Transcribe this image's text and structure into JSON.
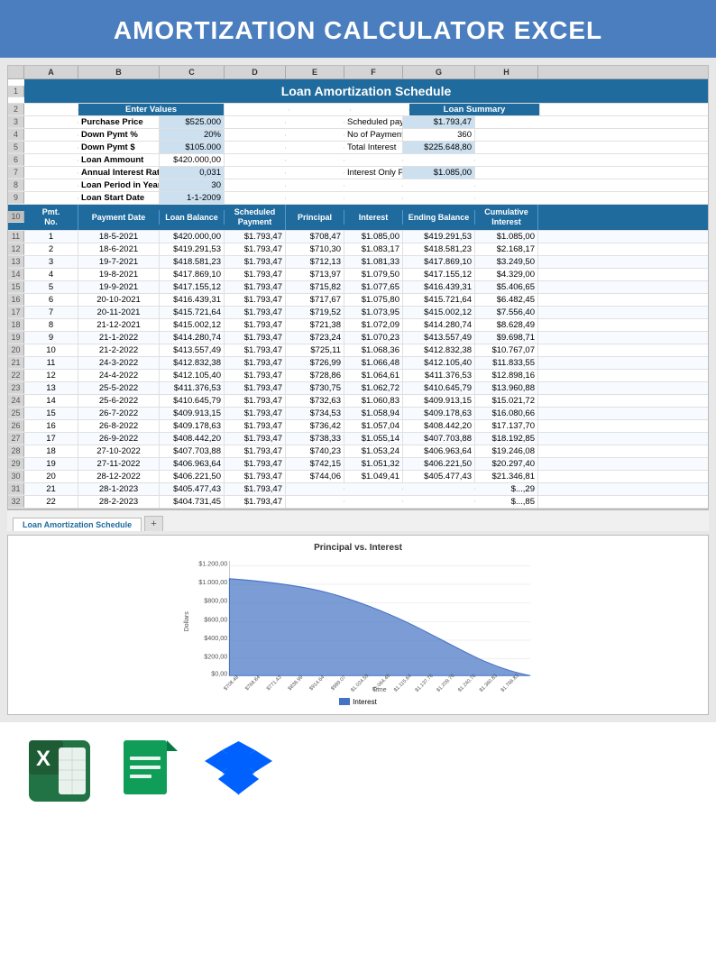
{
  "header": {
    "title": "AMORTIZATION CALCULATOR EXCEL"
  },
  "spreadsheet": {
    "col_headers": [
      "",
      "A",
      "B",
      "C",
      "D",
      "E",
      "F",
      "G",
      "H"
    ],
    "title_row": "Loan Amortization Schedule",
    "input_section": {
      "header": "Enter Values",
      "fields": [
        {
          "label": "Purchase Price",
          "value": "$525.000"
        },
        {
          "label": "Down Pymt %",
          "value": "20%"
        },
        {
          "label": "Down Pymt $",
          "value": "$105.000"
        },
        {
          "label": "Loan Ammount",
          "value": "$420.000,00"
        },
        {
          "label": "Annual Interest Rate",
          "value": "0,031"
        },
        {
          "label": "Loan Period in Years",
          "value": "30"
        },
        {
          "label": "Loan Start Date",
          "value": "1-1-2009"
        }
      ]
    },
    "summary_section": {
      "header": "Loan Summary",
      "fields": [
        {
          "label": "Scheduled payment",
          "value": "$1.793,47"
        },
        {
          "label": "No of Payments",
          "value": "360"
        },
        {
          "label": "Total Interest",
          "value": "$225.648,80"
        },
        {
          "label": "",
          "value": ""
        },
        {
          "label": "Interest Only Payment",
          "value": "$1.085,00"
        }
      ]
    },
    "table_headers": [
      "Pmt.\nNo.",
      "Payment Date",
      "Loan Balance",
      "Scheduled\nPayment",
      "Principal",
      "Interest",
      "Ending Balance",
      "Cumulative\nInterest"
    ],
    "table_rows": [
      [
        "1",
        "18-5-2021",
        "$420.000,00",
        "$1.793,47",
        "$708,47",
        "$1.085,00",
        "$419.291,53",
        "$1.085,00"
      ],
      [
        "2",
        "18-6-2021",
        "$419.291,53",
        "$1.793,47",
        "$710,30",
        "$1.083,17",
        "$418.581,23",
        "$2.168,17"
      ],
      [
        "3",
        "19-7-2021",
        "$418.581,23",
        "$1.793,47",
        "$712,13",
        "$1.081,33",
        "$417.869,10",
        "$3.249,50"
      ],
      [
        "4",
        "19-8-2021",
        "$417.869,10",
        "$1.793,47",
        "$713,97",
        "$1.079,50",
        "$417.155,12",
        "$4.329,00"
      ],
      [
        "5",
        "19-9-2021",
        "$417.155,12",
        "$1.793,47",
        "$715,82",
        "$1.077,65",
        "$416.439,31",
        "$5.406,65"
      ],
      [
        "6",
        "20-10-2021",
        "$416.439,31",
        "$1.793,47",
        "$717,67",
        "$1.075,80",
        "$415.721,64",
        "$6.482,45"
      ],
      [
        "7",
        "20-11-2021",
        "$415.721,64",
        "$1.793,47",
        "$719,52",
        "$1.073,95",
        "$415.002,12",
        "$7.556,40"
      ],
      [
        "8",
        "21-12-2021",
        "$415.002,12",
        "$1.793,47",
        "$721,38",
        "$1.072,09",
        "$414.280,74",
        "$8.628,49"
      ],
      [
        "9",
        "21-1-2022",
        "$414.280,74",
        "$1.793,47",
        "$723,24",
        "$1.070,23",
        "$413.557,49",
        "$9.698,71"
      ],
      [
        "10",
        "21-2-2022",
        "$413.557,49",
        "$1.793,47",
        "$725,11",
        "$1.068,36",
        "$412.832,38",
        "$10.767,07"
      ],
      [
        "11",
        "24-3-2022",
        "$412.832,38",
        "$1.793,47",
        "$726,99",
        "$1.066,48",
        "$412.105,40",
        "$11.833,55"
      ],
      [
        "12",
        "24-4-2022",
        "$412.105,40",
        "$1.793,47",
        "$728,86",
        "$1.064,61",
        "$411.376,53",
        "$12.898,16"
      ],
      [
        "13",
        "25-5-2022",
        "$411.376,53",
        "$1.793,47",
        "$730,75",
        "$1.062,72",
        "$410.645,79",
        "$13.960,88"
      ],
      [
        "14",
        "25-6-2022",
        "$410.645,79",
        "$1.793,47",
        "$732,63",
        "$1.060,83",
        "$409.913,15",
        "$15.021,72"
      ],
      [
        "15",
        "26-7-2022",
        "$409.913,15",
        "$1.793,47",
        "$734,53",
        "$1.058,94",
        "$409.178,63",
        "$16.080,66"
      ],
      [
        "16",
        "26-8-2022",
        "$409.178,63",
        "$1.793,47",
        "$736,42",
        "$1.057,04",
        "$408.442,20",
        "$17.137,70"
      ],
      [
        "17",
        "26-9-2022",
        "$408.442,20",
        "$1.793,47",
        "$738,33",
        "$1.055,14",
        "$407.703,88",
        "$18.192,85"
      ],
      [
        "18",
        "27-10-2022",
        "$407.703,88",
        "$1.793,47",
        "$740,23",
        "$1.053,24",
        "$406.963,64",
        "$19.246,08"
      ],
      [
        "19",
        "27-11-2022",
        "$406.963,64",
        "$1.793,47",
        "$742,15",
        "$1.051,32",
        "$406.221,50",
        "$20.297,40"
      ],
      [
        "20",
        "28-12-2022",
        "$406.221,50",
        "$1.793,47",
        "$744,06",
        "$1.049,41",
        "$405.477,43",
        "$21.346,81"
      ],
      [
        "21",
        "28-1-2023",
        "$405.477,43",
        "$1.793,47",
        "",
        "",
        "",
        "$...,29"
      ],
      [
        "22",
        "28-2-2023",
        "$404.731,45",
        "$1.793,47",
        "",
        "",
        "",
        "$...,85"
      ]
    ],
    "tab_name": "Loan Amortization Schedule"
  },
  "chart": {
    "title": "Principal vs. Interest",
    "y_axis_label": "Dollars",
    "x_axis_label": "Time",
    "y_labels": [
      "$1.200,00",
      "$1.000,00",
      "$800,00",
      "$600,00",
      "$400,00",
      "$200,00",
      "$0,00"
    ],
    "legend": [
      {
        "label": "Interest",
        "color": "#4472C4"
      }
    ]
  },
  "icons": [
    {
      "name": "excel",
      "color": "#217346"
    },
    {
      "name": "sheets",
      "color": "#0F9D58"
    },
    {
      "name": "dropbox",
      "color": "#0061FF"
    }
  ]
}
